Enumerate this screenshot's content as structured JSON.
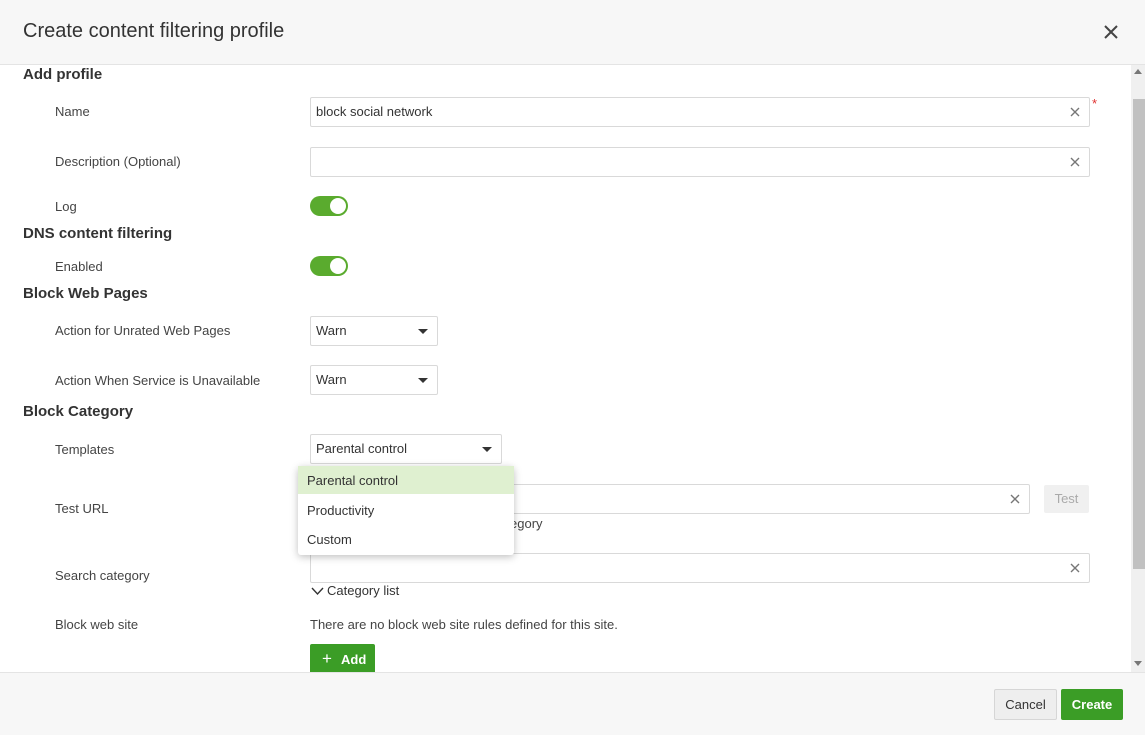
{
  "dialog": {
    "title": "Create content filtering profile"
  },
  "add_profile": {
    "heading": "Add profile",
    "name_label": "Name",
    "name_value": "block social network",
    "required_mark": "*",
    "description_label": "Description (Optional)",
    "description_value": "",
    "log_label": "Log",
    "log_enabled": true
  },
  "dns_filtering": {
    "heading": "DNS content filtering",
    "enabled_label": "Enabled",
    "enabled": true
  },
  "block_web_pages": {
    "heading": "Block Web Pages",
    "unrated_label": "Action for Unrated Web Pages",
    "unrated_value": "Warn",
    "unavailable_label": "Action When Service is Unavailable",
    "unavailable_value": "Warn"
  },
  "block_category": {
    "heading": "Block Category",
    "templates_label": "Templates",
    "templates_value": "Parental control",
    "templates_options": [
      "Parental control",
      "Productivity",
      "Custom"
    ],
    "test_url_label": "Test URL",
    "test_url_value": "",
    "test_button": "Test",
    "test_url_hint_visible_fragment": "egory",
    "search_category_label": "Search category",
    "search_category_value": "",
    "category_list_label": "Category list",
    "block_web_site_label": "Block web site",
    "no_rules_text": "There are no block web site rules defined for this site.",
    "add_button": "Add",
    "add_icon": "+"
  },
  "footer": {
    "cancel_label": "Cancel",
    "create_label": "Create"
  },
  "colors": {
    "accent_green": "#3b9d26",
    "toggle_green": "#5aab2e",
    "selected_option_bg": "#dff0d0",
    "required_red": "#e0302f"
  },
  "icons": {
    "close": "close-icon",
    "clear": "clear-icon",
    "caret": "caret-down-icon",
    "chevron": "chevron-down-icon",
    "plus": "plus-icon"
  }
}
